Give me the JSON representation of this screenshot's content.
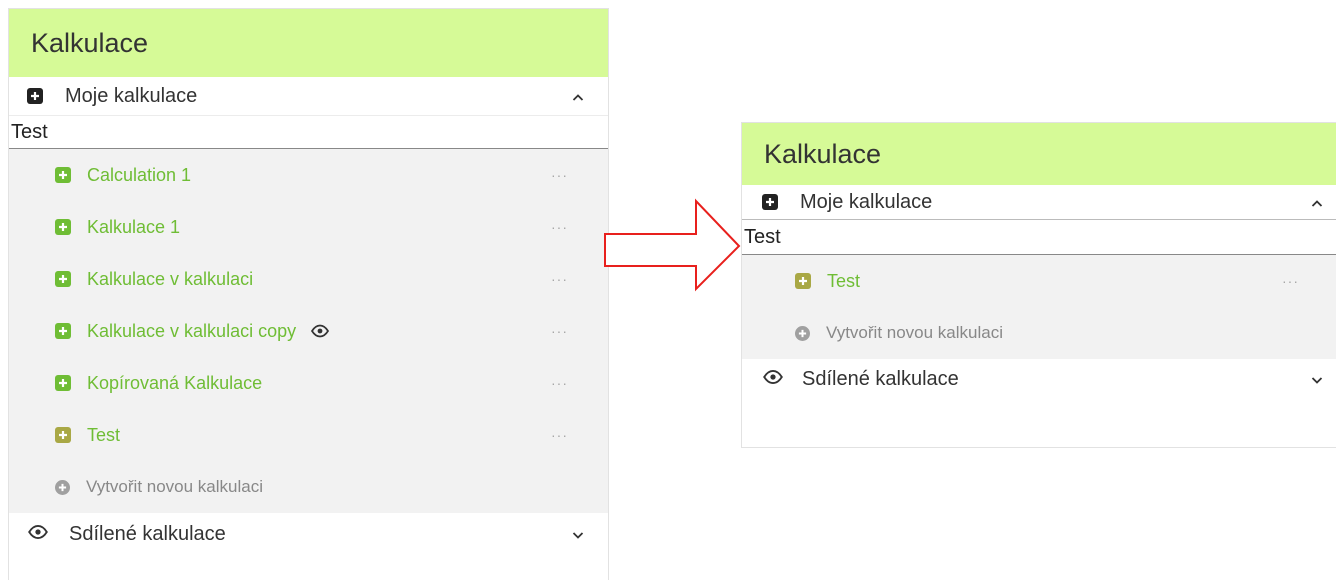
{
  "left": {
    "title": "Kalkulace",
    "section_mine": "Moje kalkulace",
    "search_value": "Test",
    "items": [
      {
        "label": "Calculation 1",
        "more": "···"
      },
      {
        "label": "Kalkulace 1",
        "more": "···"
      },
      {
        "label": "Kalkulace v kalkulaci",
        "more": "···"
      },
      {
        "label": "Kalkulace v kalkulaci copy",
        "more": "···"
      },
      {
        "label": "Kopírovaná Kalkulace",
        "more": "···"
      },
      {
        "label": "Test",
        "more": "···"
      }
    ],
    "create_label": "Vytvořit novou kalkulaci",
    "section_shared": "Sdílené kalkulace"
  },
  "right": {
    "title": "Kalkulace",
    "section_mine": "Moje kalkulace",
    "search_value": "Test",
    "items": [
      {
        "label": "Test",
        "more": "···"
      }
    ],
    "create_label": "Vytvořit novou kalkulaci",
    "section_shared": "Sdílené kalkulace"
  },
  "colors": {
    "header_bg": "#d6fa97",
    "item_green": "#6fbd35",
    "arrow_red": "#e8201d",
    "list_bg": "#f2f2f2"
  },
  "icons": {
    "section_plus": "plus-square-icon",
    "item_plus": "plus-square-icon",
    "create": "plus-circle-icon",
    "shared": "eye-icon",
    "expand": "chevron-up-icon",
    "collapse": "chevron-down-icon",
    "more": "ellipsis-icon",
    "arrow": "arrow-right-icon"
  }
}
